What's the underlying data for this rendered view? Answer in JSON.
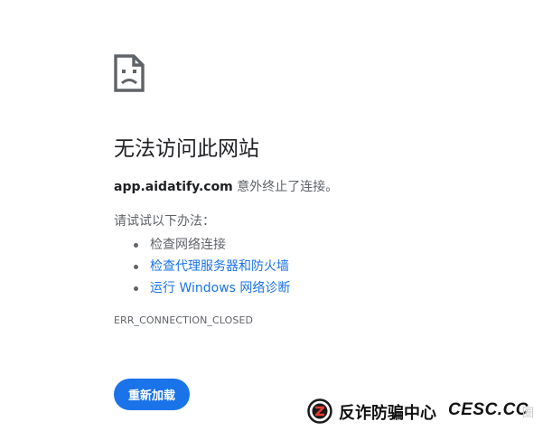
{
  "error_page": {
    "title": "无法访问此网站",
    "host": "app.aidatify.com",
    "message": " 意外终止了连接。",
    "try_label": "请试试以下办法：",
    "suggestions": [
      {
        "label": "检查网络连接",
        "link": false
      },
      {
        "label": "检查代理服务器和防火墙",
        "link": true
      },
      {
        "label": "运行 Windows 网络诊断",
        "link": true
      }
    ],
    "error_code": "ERR_CONNECTION_CLOSED",
    "reload_label": "重新加载",
    "icon": "sad-page-icon"
  },
  "watermark": {
    "text": "反诈防骗中心",
    "brand": "CESC.CC",
    "faint": "圈"
  },
  "colors": {
    "link": "#1a73e8",
    "button": "#1a73e8",
    "title": "#202124",
    "text": "#5f6368"
  }
}
